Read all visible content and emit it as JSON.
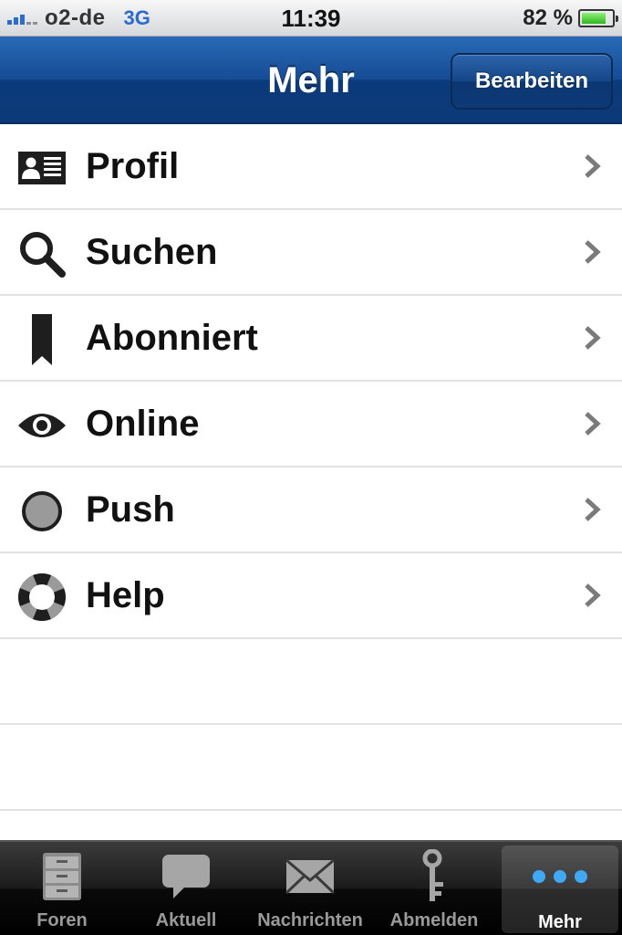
{
  "status_bar": {
    "carrier": "o2-de",
    "network": "3G",
    "time": "11:39",
    "battery_percent": "82 %",
    "battery_level": 0.82,
    "signal_bars": 3
  },
  "nav": {
    "title": "Mehr",
    "edit_label": "Bearbeiten"
  },
  "menu": {
    "items": [
      {
        "label": "Profil",
        "icon": "profile-card-icon"
      },
      {
        "label": "Suchen",
        "icon": "search-icon"
      },
      {
        "label": "Abonniert",
        "icon": "bookmark-icon"
      },
      {
        "label": "Online",
        "icon": "eye-icon"
      },
      {
        "label": "Push",
        "icon": "circle-icon"
      },
      {
        "label": "Help",
        "icon": "lifebuoy-icon"
      }
    ]
  },
  "tabbar": {
    "tabs": [
      {
        "label": "Foren",
        "icon": "filing-cabinet-icon"
      },
      {
        "label": "Aktuell",
        "icon": "speech-bubble-icon"
      },
      {
        "label": "Nachrichten",
        "icon": "envelope-icon"
      },
      {
        "label": "Abmelden",
        "icon": "key-icon"
      },
      {
        "label": "Mehr",
        "icon": "more-dots-icon",
        "active": true
      }
    ]
  },
  "colors": {
    "nav_blue": "#154c94",
    "dots_blue": "#3fa9f5",
    "network_blue": "#2b6bd1"
  }
}
